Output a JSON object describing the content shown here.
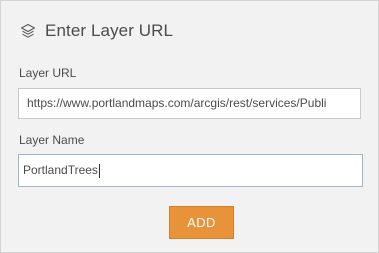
{
  "header": {
    "title": "Enter Layer URL",
    "icon": "layers-icon"
  },
  "form": {
    "url_label": "Layer URL",
    "url_value": "https://www.portlandmaps.com/arcgis/rest/services/Publi",
    "name_label": "Layer Name",
    "name_value": "PortlandTrees",
    "add_label": "ADD"
  },
  "colors": {
    "accent": "#e8933a",
    "panel_bg": "#f2f2f2",
    "text": "#4c4c4c",
    "focus_border": "#9db6cc"
  }
}
